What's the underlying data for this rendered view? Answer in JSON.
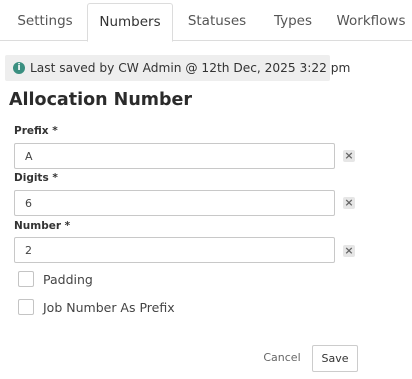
{
  "tabs": [
    {
      "label": "Settings",
      "active": false
    },
    {
      "label": "Numbers",
      "active": true
    },
    {
      "label": "Statuses",
      "active": false
    },
    {
      "label": "Types",
      "active": false
    },
    {
      "label": "Workflows",
      "active": false
    }
  ],
  "notice": {
    "icon": "info-icon",
    "icon_glyph": "i",
    "text": "Last saved by CW Admin @ 12th Dec, 2025 3:22 pm",
    "icon_color": "#3a8f80"
  },
  "section_title": "Allocation Number",
  "fields": [
    {
      "label": "Prefix *",
      "value": "A"
    },
    {
      "label": "Digits *",
      "value": "6"
    },
    {
      "label": "Number *",
      "value": "2"
    }
  ],
  "clear_icon_glyph": "×",
  "checkboxes": [
    {
      "label": "Padding",
      "checked": false
    },
    {
      "label": "Job Number As Prefix",
      "checked": false
    }
  ],
  "actions": {
    "cancel_label": "Cancel",
    "save_label": "Save"
  }
}
